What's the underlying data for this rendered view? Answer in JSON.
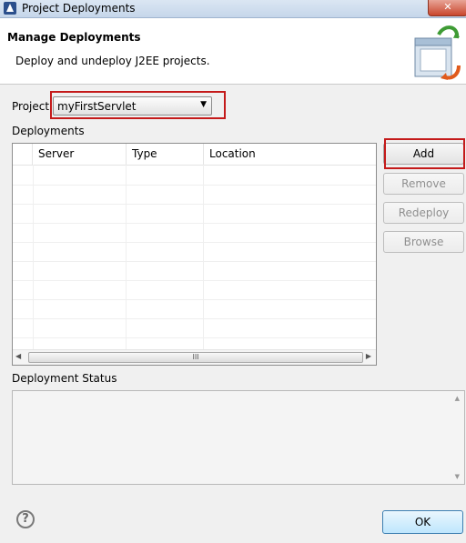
{
  "window": {
    "title": "Project Deployments",
    "close_glyph": "✕"
  },
  "banner": {
    "heading": "Manage Deployments",
    "description": "Deploy and undeploy J2EE projects.",
    "icon": "deploy-wizard-icon"
  },
  "project": {
    "label": "Project",
    "selected": "myFirstServlet"
  },
  "deployments": {
    "label": "Deployments",
    "columns": [
      "Server",
      "Type",
      "Location"
    ],
    "rows": [],
    "scroll_grip": "III"
  },
  "buttons": {
    "add": "Add",
    "remove": "Remove",
    "redeploy": "Redeploy",
    "browse": "Browse",
    "ok": "OK"
  },
  "status": {
    "label": "Deployment Status",
    "text": ""
  },
  "help": {
    "glyph": "?"
  },
  "colors": {
    "highlight": "#c41a1a",
    "ok_button": "#bee6fd"
  }
}
